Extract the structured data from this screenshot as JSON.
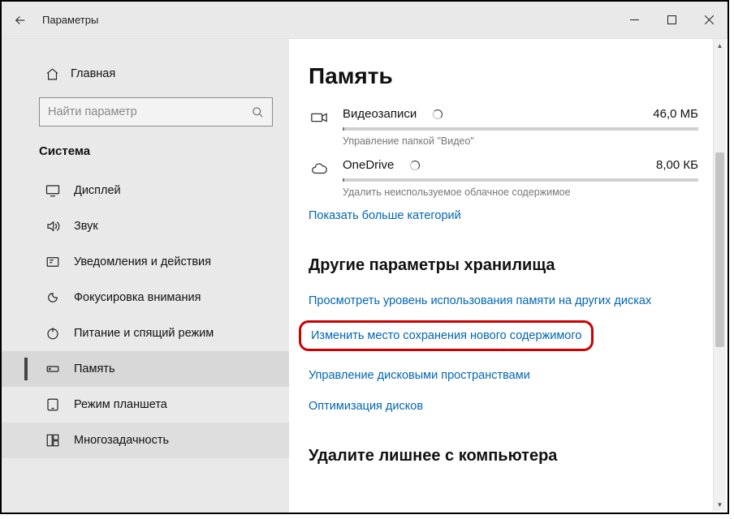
{
  "titlebar": {
    "app_title": "Параметры"
  },
  "sidebar": {
    "home_label": "Главная",
    "search_placeholder": "Найти параметр",
    "section_title": "Система",
    "items": [
      {
        "label": "Дисплей"
      },
      {
        "label": "Звук"
      },
      {
        "label": "Уведомления и действия"
      },
      {
        "label": "Фокусировка внимания"
      },
      {
        "label": "Питание и спящий режим"
      },
      {
        "label": "Память"
      },
      {
        "label": "Режим планшета"
      },
      {
        "label": "Многозадачность"
      }
    ]
  },
  "content": {
    "heading": "Память",
    "categories": [
      {
        "name": "Видеозаписи",
        "size": "46,0 МБ",
        "sub": "Управление папкой \"Видео\""
      },
      {
        "name": "OneDrive",
        "size": "8,00 КБ",
        "sub": "Удалить неиспользуемое облачное содержимое"
      }
    ],
    "show_more": "Показать больше категорий",
    "other_heading": "Другие параметры хранилища",
    "other_links": [
      "Просмотреть уровень использования памяти на других дисках",
      "Изменить место сохранения нового содержимого",
      "Управление дисковыми пространствами",
      "Оптимизация дисков"
    ],
    "cleanup_heading": "Удалите лишнее с компьютера"
  }
}
